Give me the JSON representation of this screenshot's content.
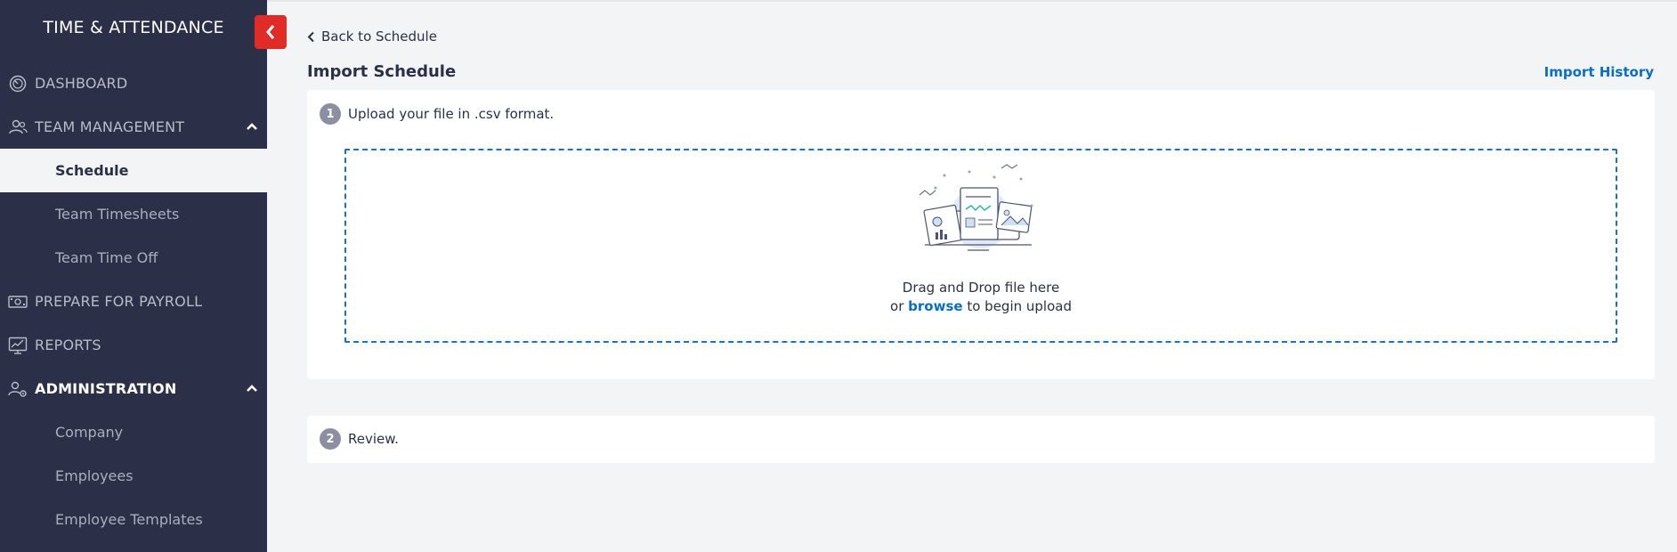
{
  "sidebar": {
    "title": "TIME & ATTENDANCE",
    "items": [
      {
        "label": "DASHBOARD"
      },
      {
        "label": "TEAM MANAGEMENT"
      },
      {
        "label": "PREPARE FOR PAYROLL"
      },
      {
        "label": "REPORTS"
      },
      {
        "label": "ADMINISTRATION"
      }
    ],
    "team_sub": [
      {
        "label": "Schedule"
      },
      {
        "label": "Team Timesheets"
      },
      {
        "label": "Team Time Off"
      }
    ],
    "admin_sub": [
      {
        "label": "Company"
      },
      {
        "label": "Employees"
      },
      {
        "label": "Employee Templates"
      }
    ]
  },
  "main": {
    "back_label": "Back to Schedule",
    "title": "Import Schedule",
    "import_history": "Import History",
    "step1": {
      "num": "1",
      "label": "Upload your file in .csv format."
    },
    "dropzone": {
      "line1": "Drag and Drop file here",
      "line2_prefix": "or",
      "browse": "browse",
      "line2_suffix": "to begin upload"
    },
    "step2": {
      "num": "2",
      "label": "Review."
    }
  },
  "colors": {
    "sidebar_bg": "#2b3048",
    "accent_red": "#e02b27",
    "link_blue": "#0a6fc2",
    "dropzone_border": "#1a6fc9"
  }
}
